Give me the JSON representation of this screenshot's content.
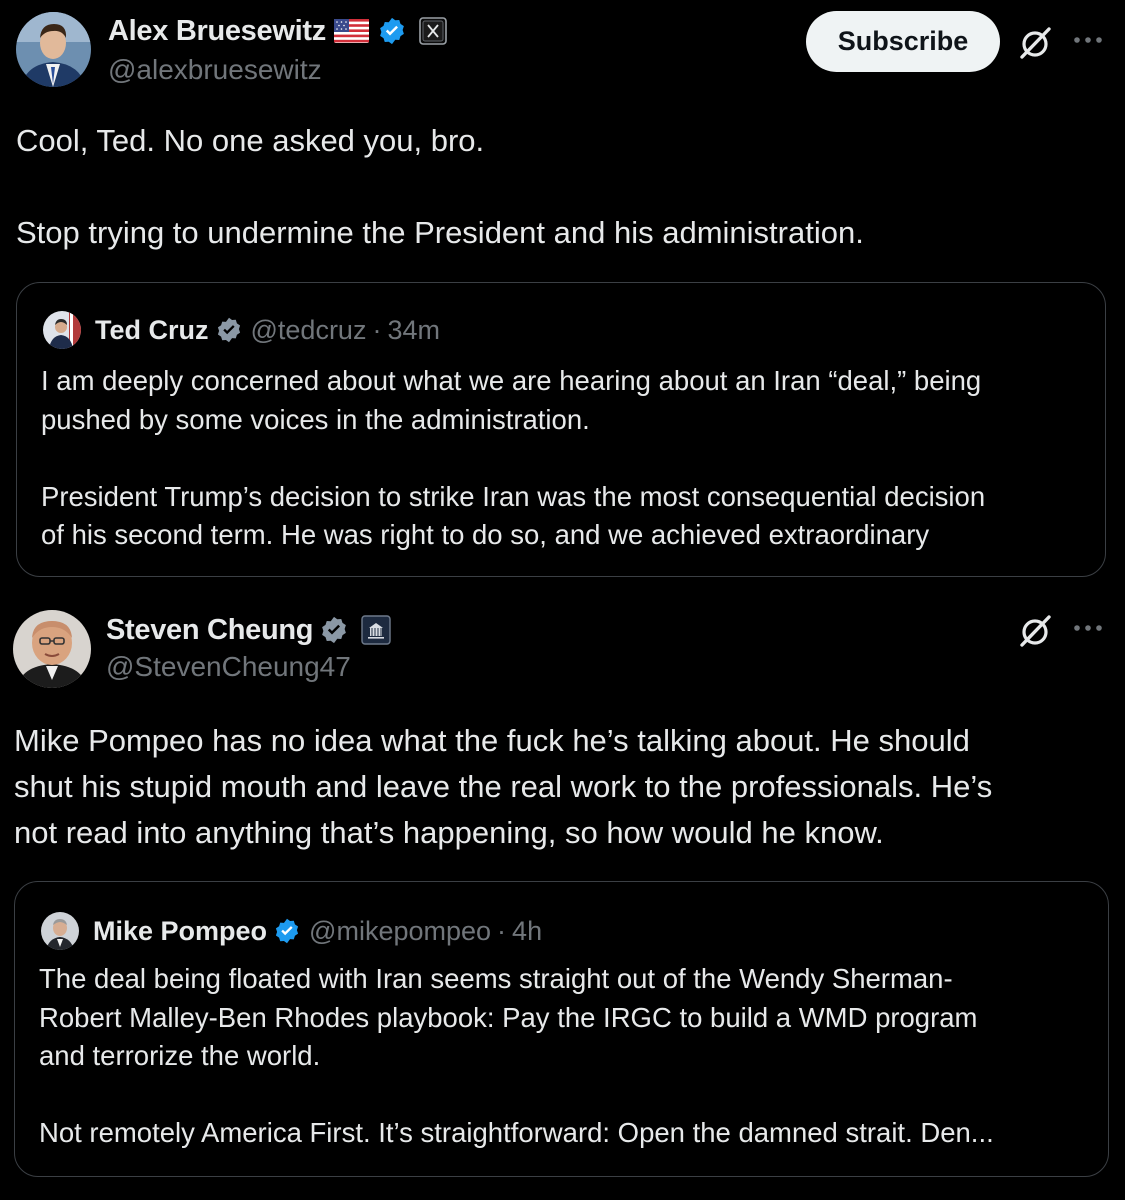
{
  "colors": {
    "background": "#000000",
    "text_primary": "#e7e9ea",
    "text_secondary": "#71767b",
    "verified_badge": "#1d9bf0",
    "quote_border": "#3b3f44",
    "subscribe_bg": "#eff3f4"
  },
  "posts": [
    {
      "author": {
        "display_name": "Alex Bruesewitz",
        "handle": "@alexbruesewitz",
        "flag_icon": "us-flag-icon",
        "verified_icon": "verified-badge-icon",
        "affiliate_icon": "x-affiliate-badge-icon"
      },
      "subscribe_label": "Subscribe",
      "grok_icon": "grok-icon",
      "more_icon": "more-horizontal-icon",
      "text_lines": [
        "Cool, Ted. No one asked you, bro.",
        "",
        "Stop trying to undermine the President and his administration."
      ],
      "quote": {
        "display_name": "Ted Cruz",
        "handle": "@tedcruz",
        "separator": "·",
        "time": "34m",
        "text_lines": [
          "I am deeply concerned about what we are hearing about an Iran “deal,” being",
          "pushed by some voices in the administration.",
          "",
          "President Trump’s decision to strike Iran was the most consequential decision",
          "of his second term. He was right to do so, and we achieved extraordinary"
        ]
      }
    },
    {
      "author": {
        "display_name": "Steven Cheung",
        "handle": "@StevenCheung47",
        "verified_icon": "verified-badge-icon",
        "affiliate_icon": "white-house-affiliate-badge-icon"
      },
      "grok_icon": "grok-icon",
      "more_icon": "more-horizontal-icon",
      "text_lines": [
        "Mike Pompeo has no idea what the fuck he’s talking about. He should",
        "shut his stupid mouth and leave the real work to the professionals. He’s",
        "not read into anything that’s happening, so how would he know."
      ],
      "quote": {
        "display_name": "Mike Pompeo",
        "handle": "@mikepompeo",
        "separator": "·",
        "time": "4h",
        "text_lines": [
          "The deal being floated with Iran seems straight out of the Wendy Sherman-",
          "Robert Malley-Ben Rhodes playbook: Pay the IRGC to build a WMD program",
          "and terrorize the world.",
          "",
          "Not remotely America First. It’s straightforward: Open the damned strait. Den..."
        ]
      }
    }
  ]
}
